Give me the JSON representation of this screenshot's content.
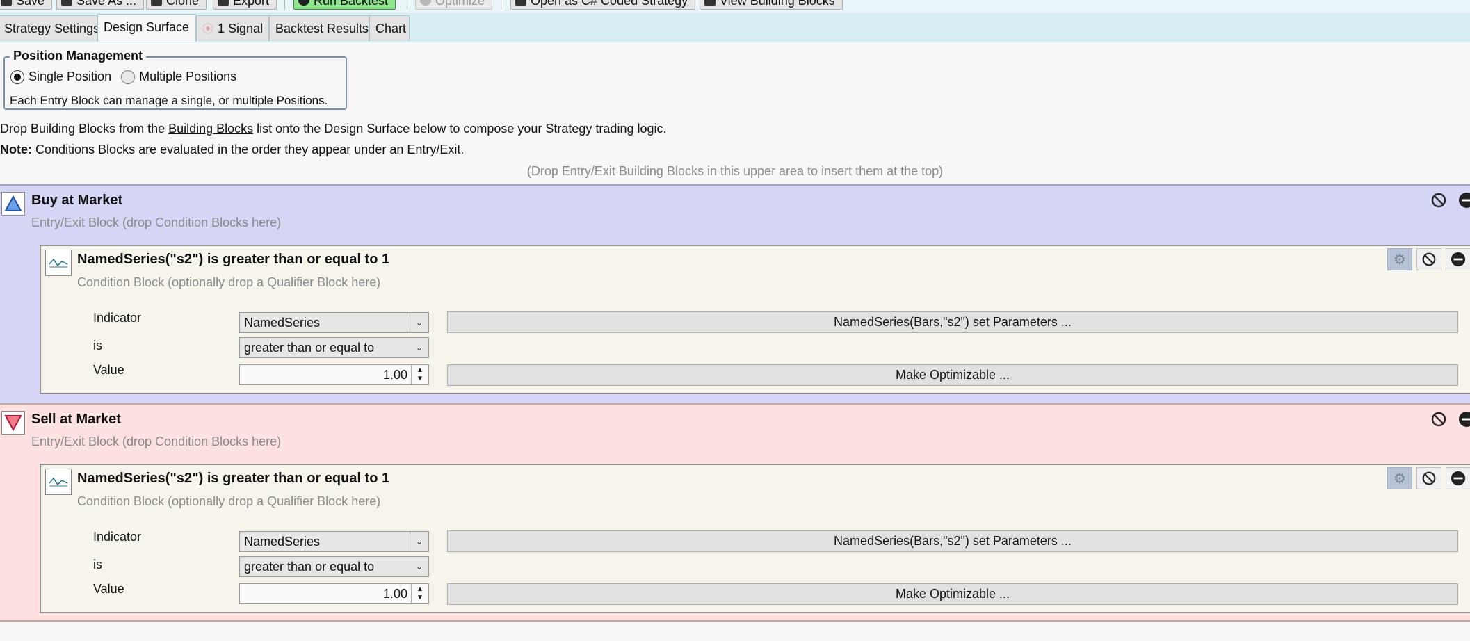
{
  "toolbar": {
    "save": "Save",
    "save_as": "Save As ...",
    "clone": "Clone",
    "export": "Export",
    "run_backtest": "Run Backtest",
    "optimize": "Optimize",
    "open_csharp": "Open as C# Coded Strategy",
    "view_building_blocks": "View Building Blocks"
  },
  "tabs": [
    {
      "label": "Strategy Settings"
    },
    {
      "label": "Design Surface"
    },
    {
      "label": "1 Signal"
    },
    {
      "label": "Backtest Results"
    },
    {
      "label": "Chart"
    }
  ],
  "active_tab": "Design Surface",
  "position_management": {
    "legend": "Position Management",
    "options": [
      "Single Position",
      "Multiple Positions"
    ],
    "selected": "Single Position",
    "help": "Each Entry Block can manage a single, or multiple Positions."
  },
  "instructions": {
    "line1_prefix": "Drop Building Blocks from the ",
    "line1_link": "Building Blocks",
    "line1_suffix": " list onto the Design Surface below to compose your Strategy trading logic.",
    "note_label": "Note:",
    "note_text": " Conditions Blocks are evaluated in the order they appear under an Entry/Exit.",
    "drop_hint": "(Drop Entry/Exit Building Blocks in this upper area to insert them at the top)"
  },
  "blocks": [
    {
      "title": "Buy at Market",
      "subtitle": "Entry/Exit Block (drop Condition Blocks here)",
      "color": "#d5d5f5",
      "condition": {
        "title": "NamedSeries(\"s2\") is greater than or equal to 1",
        "subtitle": "Condition Block (optionally drop a Qualifier Block here)",
        "indicator_label": "Indicator",
        "indicator_value": "NamedSeries",
        "is_label": "is",
        "is_value": "greater than or equal to",
        "value_label": "Value",
        "value": "1.00",
        "params_button": "NamedSeries(Bars,\"s2\") set Parameters ...",
        "optimize_button": "Make Optimizable ..."
      }
    },
    {
      "title": "Sell at Market",
      "subtitle": "Entry/Exit Block (drop Condition Blocks here)",
      "color": "#fde1e1",
      "condition": {
        "title": "NamedSeries(\"s2\") is greater than or equal to 1",
        "subtitle": "Condition Block (optionally drop a Qualifier Block here)",
        "indicator_label": "Indicator",
        "indicator_value": "NamedSeries",
        "is_label": "is",
        "is_value": "greater than or equal to",
        "value_label": "Value",
        "value": "1.00",
        "params_button": "NamedSeries(Bars,\"s2\") set Parameters ...",
        "optimize_button": "Make Optimizable ..."
      }
    }
  ]
}
